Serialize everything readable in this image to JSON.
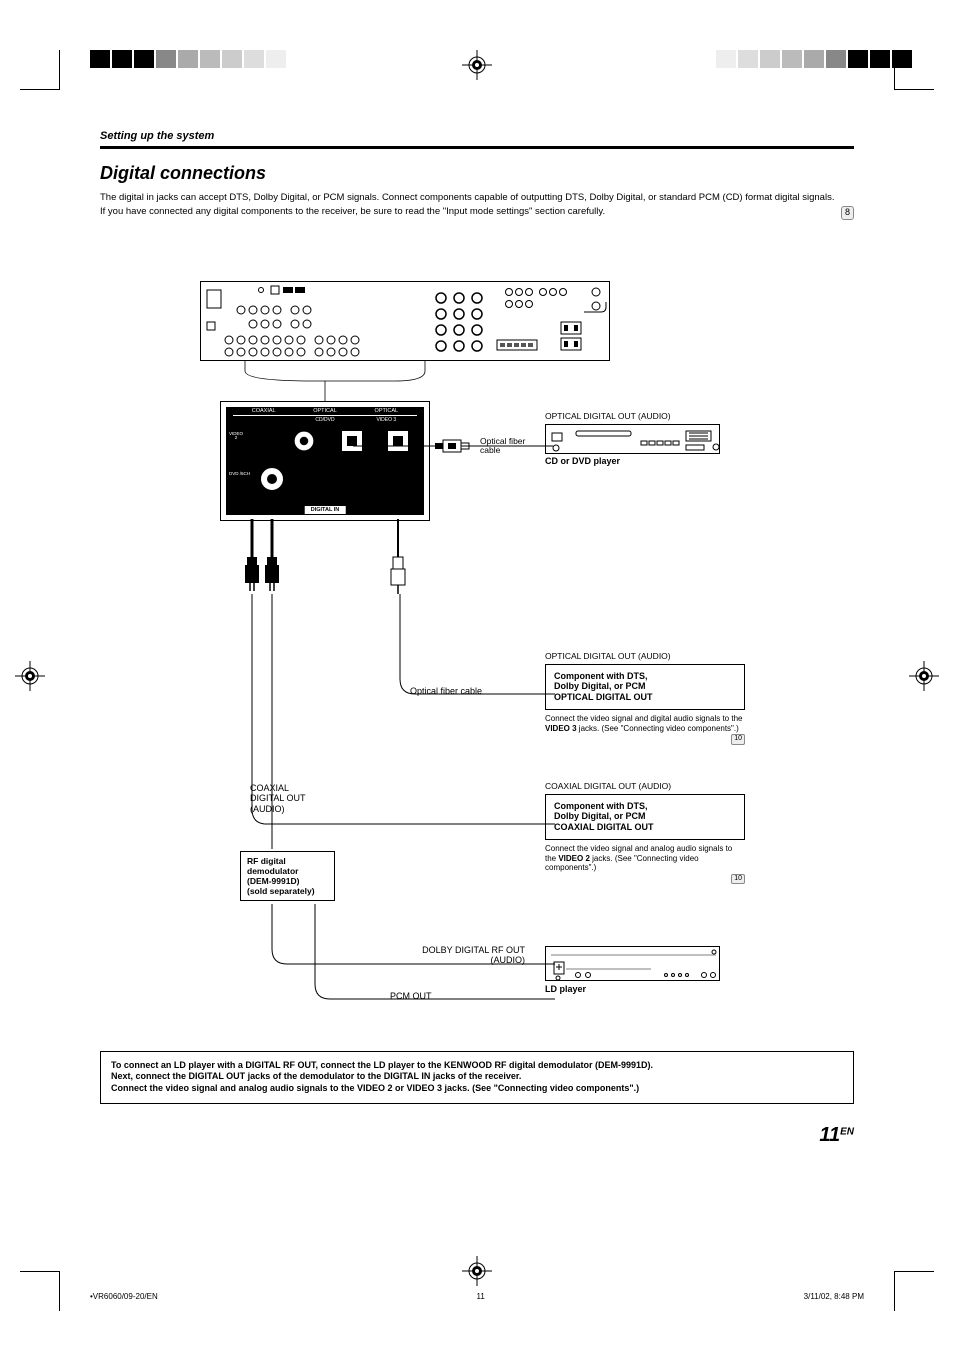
{
  "header": {
    "section_label": "Setting up the system",
    "title": "Digital connections"
  },
  "intro": {
    "p1": "The digital in jacks can accept DTS, Dolby Digital, or PCM signals. Connect components capable of outputting DTS, Dolby Digital, or standard PCM (CD) format digital signals.",
    "p2": "If you have connected any digital components to the receiver, be sure to read the \"Input mode settings\" section carefully.",
    "page_ref": "8"
  },
  "panel": {
    "col1": "COAXIAL",
    "col2": "OPTICAL",
    "col3": "OPTICAL",
    "sub2": "CD/DVD",
    "sub3": "VIDEO 3",
    "side_video2": "VIDEO",
    "side_video2_num": "2",
    "side_dvd": "DVD /6CH",
    "bottom": "DIGITAL IN"
  },
  "devices": {
    "optical_out1": "OPTICAL DIGITAL OUT (AUDIO)",
    "cable1": "Optical fiber cable",
    "device1": "CD or DVD player",
    "optical_out2": "OPTICAL DIGITAL OUT (AUDIO)",
    "cable2": "Optical fiber cable",
    "comp1_l1": "Component with DTS,",
    "comp1_l2": "Dolby Digital, or PCM",
    "comp1_l3": "OPTICAL DIGITAL OUT",
    "comp1_note_a": "Connect the video signal and digital audio signals to the ",
    "comp1_note_b": "VIDEO 3",
    "comp1_note_c": " jacks. (See \"Connecting video components\".)",
    "comp1_ref": "10",
    "coax_out": "COAXIAL DIGITAL OUT (AUDIO)",
    "comp2_l1": "Component with DTS,",
    "comp2_l2": "Dolby Digital, or PCM",
    "comp2_l3": "COAXIAL DIGITAL OUT",
    "comp2_note_a": "Connect the video signal and analog audio signals to the ",
    "comp2_note_b": "VIDEO 2",
    "comp2_note_c": " jacks. (See \"Connecting video components\".)",
    "comp2_ref": "10",
    "side_coax": "COAXIAL DIGITAL OUT (AUDIO)",
    "rf_l1": "RF digital",
    "rf_l2": "demodulator",
    "rf_l3": "(DEM-9991D)",
    "rf_l4": "(sold separately)",
    "dolby_rf": "DOLBY DIGITAL RF OUT (AUDIO)",
    "pcm_out": "PCM OUT",
    "ld": "LD player"
  },
  "note_box": {
    "l1": "To connect an LD player with a DIGITAL RF OUT, connect the LD player to the KENWOOD RF digital demodulator (DEM-9991D).",
    "l2": "Next, connect the DIGITAL OUT jacks of the demodulator to the DIGITAL IN jacks of the receiver.",
    "l3": "Connect the video signal and analog audio signals to the VIDEO 2 or VIDEO 3 jacks. (See \"Connecting video components\".)"
  },
  "page_number": {
    "num": "11",
    "lang": "EN"
  },
  "footer": {
    "left": "•VR6060/09-20/EN",
    "center": "11",
    "right": "3/11/02, 8:48 PM"
  }
}
